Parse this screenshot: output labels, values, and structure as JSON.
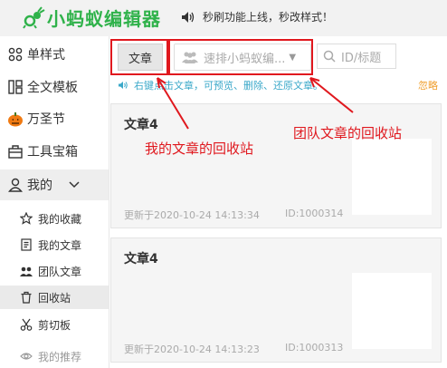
{
  "header": {
    "logo_text": "小蚂蚁编辑器",
    "announcement": "秒刷功能上线，秒改样式！"
  },
  "sidebar": {
    "items": [
      {
        "label": "单样式"
      },
      {
        "label": "全文模板"
      },
      {
        "label": "万圣节"
      },
      {
        "label": "工具宝箱"
      },
      {
        "label": "我的"
      }
    ],
    "sub_items": [
      {
        "label": "我的收藏"
      },
      {
        "label": "我的文章"
      },
      {
        "label": "团队文章"
      },
      {
        "label": "回收站"
      },
      {
        "label": "剪切板"
      },
      {
        "label": "我的推荐"
      }
    ]
  },
  "toolbar": {
    "article_button": "文章",
    "team_placeholder": "速排小蚂蚁编...",
    "search_placeholder": "ID/标题"
  },
  "tip": {
    "text": "右键点击文章，可预览、删除、还原文章。",
    "help": "忽略"
  },
  "cards": [
    {
      "title": "文章4",
      "updated": "更新于2020-10-24 14:13:34",
      "id": "ID:1000314"
    },
    {
      "title": "文章4",
      "updated": "更新于2020-10-24 14:13:23",
      "id": "ID:1000313"
    }
  ],
  "annotations": {
    "my_recycle": "我的文章的回收站",
    "team_recycle": "团队文章的回收站"
  },
  "colors": {
    "brand_green": "#2fb24a",
    "annotation_red": "#e0181e",
    "tip_blue": "#3aa8c9",
    "help_orange": "#f0a030"
  }
}
